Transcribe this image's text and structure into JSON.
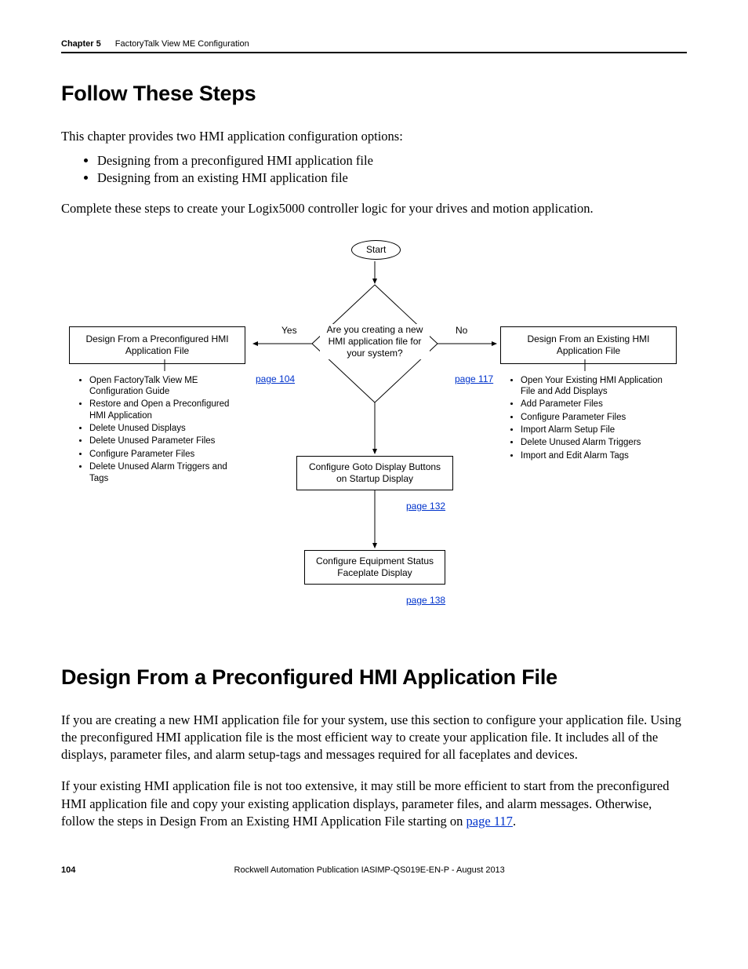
{
  "header": {
    "chapter_label": "Chapter 5",
    "chapter_title": "FactoryTalk View ME Configuration"
  },
  "section1": {
    "heading": "Follow These Steps",
    "intro": "This chapter provides two HMI application configuration options:",
    "options": [
      "Designing from a preconfigured HMI application file",
      "Designing from an existing HMI application file"
    ],
    "after": "Complete these steps to create your Logix5000 controller logic for your drives and motion application."
  },
  "flow": {
    "start": "Start",
    "decision": "Are you creating a new HMI application file for your system?",
    "yes": "Yes",
    "no": "No",
    "left_box": "Design From a Preconfigured HMI Application File",
    "right_box": "Design From an Existing HMI Application File",
    "left_link": "page 104",
    "right_link": "page 117",
    "left_items": [
      "Open FactoryTalk View ME Configuration Guide",
      "Restore and Open a Preconfigured HMI Application",
      "Delete Unused Displays",
      "Delete Unused Parameter Files",
      "Configure Parameter Files",
      "Delete Unused Alarm Triggers and Tags"
    ],
    "right_items": [
      "Open Your Existing HMI Application File and Add Displays",
      "Add Parameter Files",
      "Configure Parameter Files",
      "Import Alarm Setup File",
      "Delete Unused Alarm Triggers",
      "Import and Edit Alarm Tags"
    ],
    "mid_box": "Configure Goto Display Buttons on Startup Display",
    "mid_link": "page 132",
    "bot_box": "Configure Equipment Status Faceplate Display",
    "bot_link": "page 138"
  },
  "section2": {
    "heading": "Design From a Preconfigured HMI Application File",
    "p1": "If you are creating a new HMI application file for your system, use this section to configure your application file. Using the preconfigured HMI application file is the most efficient way to create your application file. It includes all of the displays, parameter files, and alarm setup-tags and messages required for all faceplates and devices.",
    "p2a": "If your existing HMI application file is not too extensive, it may still be more efficient to start from the preconfigured HMI application file and copy your existing application displays, parameter files, and alarm messages. Otherwise, follow the steps in Design From an Existing HMI Application File starting on ",
    "p2link": "page 117",
    "p2b": "."
  },
  "footer": {
    "page_number": "104",
    "publication": "Rockwell Automation Publication IASIMP-QS019E-EN-P - August 2013"
  }
}
